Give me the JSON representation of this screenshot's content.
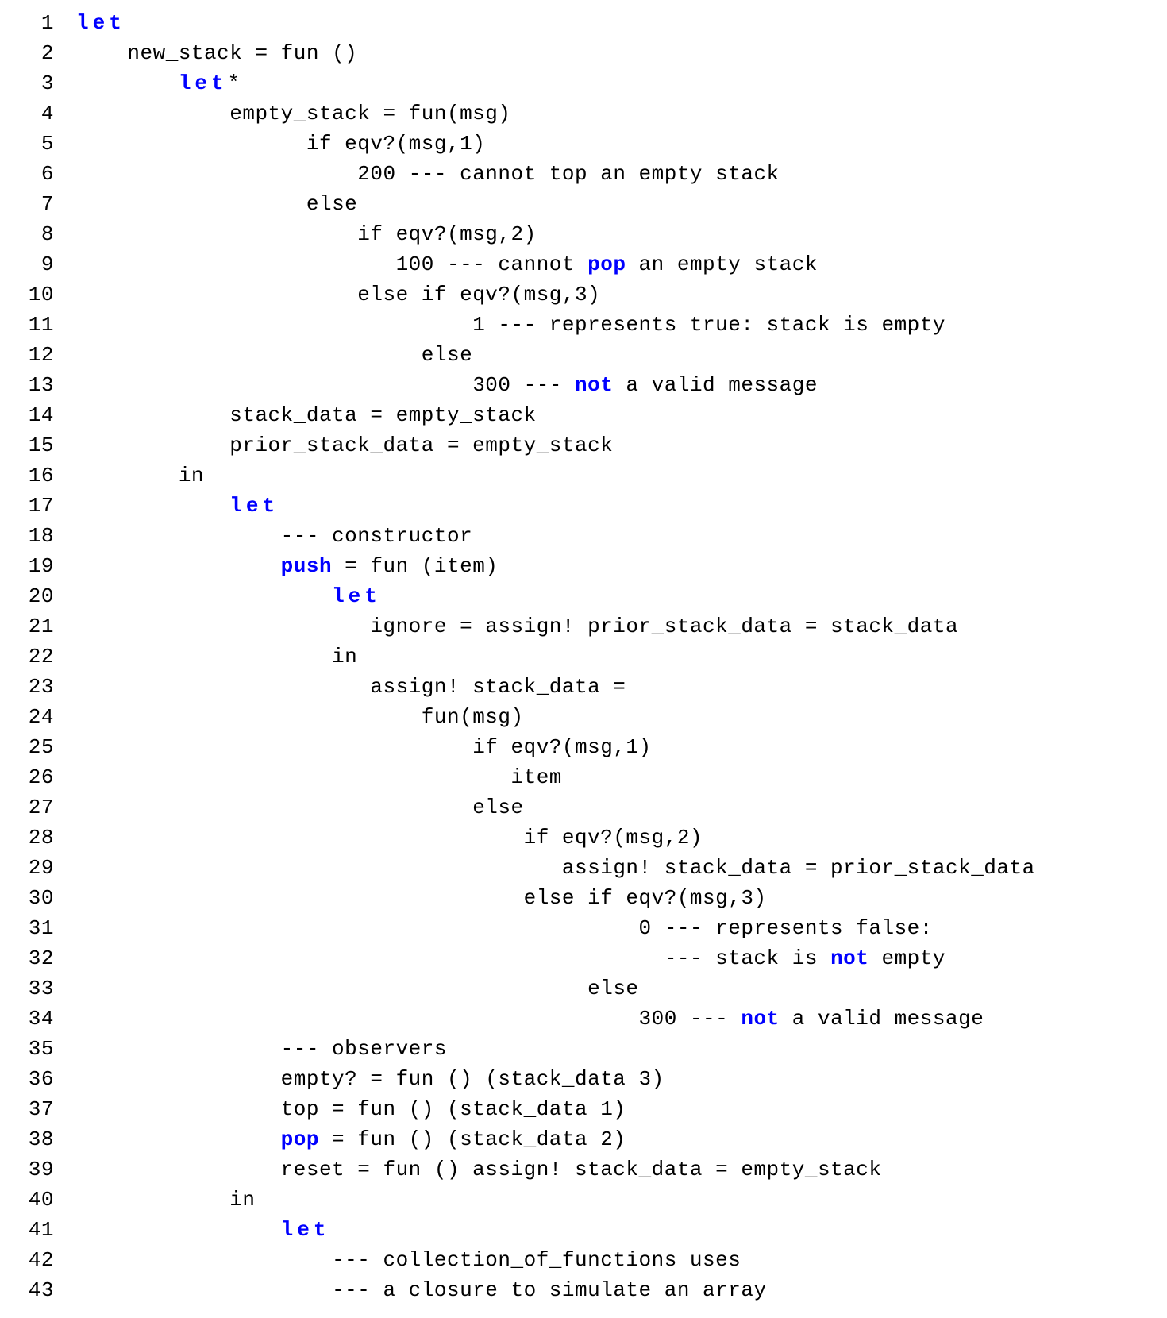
{
  "code": {
    "lines": [
      {
        "n": 1,
        "tokens": [
          {
            "t": "kw",
            "v": "let"
          }
        ]
      },
      {
        "n": 2,
        "indent": 4,
        "tokens": [
          {
            "t": "p",
            "v": "new_stack = fun ()"
          }
        ]
      },
      {
        "n": 3,
        "indent": 8,
        "tokens": [
          {
            "t": "kw",
            "v": "let"
          },
          {
            "t": "p",
            "v": "*"
          }
        ]
      },
      {
        "n": 4,
        "indent": 12,
        "tokens": [
          {
            "t": "p",
            "v": "empty_stack = fun(msg)"
          }
        ]
      },
      {
        "n": 5,
        "indent": 18,
        "tokens": [
          {
            "t": "p",
            "v": "if eqv?(msg,1)"
          }
        ]
      },
      {
        "n": 6,
        "indent": 22,
        "tokens": [
          {
            "t": "p",
            "v": "200 --- cannot top an empty stack"
          }
        ]
      },
      {
        "n": 7,
        "indent": 18,
        "tokens": [
          {
            "t": "p",
            "v": "else"
          }
        ]
      },
      {
        "n": 8,
        "indent": 22,
        "tokens": [
          {
            "t": "p",
            "v": "if eqv?(msg,2)"
          }
        ]
      },
      {
        "n": 9,
        "indent": 25,
        "tokens": [
          {
            "t": "p",
            "v": "100 --- cannot "
          },
          {
            "t": "kw2",
            "v": "pop"
          },
          {
            "t": "p",
            "v": " an empty stack"
          }
        ]
      },
      {
        "n": 10,
        "indent": 22,
        "tokens": [
          {
            "t": "p",
            "v": "else if eqv?(msg,3)"
          }
        ]
      },
      {
        "n": 11,
        "indent": 31,
        "tokens": [
          {
            "t": "p",
            "v": "1 --- represents true: stack is empty"
          }
        ]
      },
      {
        "n": 12,
        "indent": 27,
        "tokens": [
          {
            "t": "p",
            "v": "else"
          }
        ]
      },
      {
        "n": 13,
        "indent": 31,
        "tokens": [
          {
            "t": "p",
            "v": "300 --- "
          },
          {
            "t": "kw2",
            "v": "not"
          },
          {
            "t": "p",
            "v": " a valid message"
          }
        ]
      },
      {
        "n": 14,
        "indent": 12,
        "tokens": [
          {
            "t": "p",
            "v": "stack_data = empty_stack"
          }
        ]
      },
      {
        "n": 15,
        "indent": 12,
        "tokens": [
          {
            "t": "p",
            "v": "prior_stack_data = empty_stack"
          }
        ]
      },
      {
        "n": 16,
        "indent": 8,
        "tokens": [
          {
            "t": "p",
            "v": "in"
          }
        ]
      },
      {
        "n": 17,
        "indent": 12,
        "tokens": [
          {
            "t": "kw",
            "v": "let"
          }
        ]
      },
      {
        "n": 18,
        "indent": 16,
        "tokens": [
          {
            "t": "p",
            "v": "--- constructor"
          }
        ]
      },
      {
        "n": 19,
        "indent": 16,
        "tokens": [
          {
            "t": "kw2",
            "v": "push"
          },
          {
            "t": "p",
            "v": " = fun (item)"
          }
        ]
      },
      {
        "n": 20,
        "indent": 20,
        "tokens": [
          {
            "t": "kw",
            "v": "let"
          }
        ]
      },
      {
        "n": 21,
        "indent": 23,
        "tokens": [
          {
            "t": "p",
            "v": "ignore = assign! prior_stack_data = stack_data"
          }
        ]
      },
      {
        "n": 22,
        "indent": 20,
        "tokens": [
          {
            "t": "p",
            "v": "in"
          }
        ]
      },
      {
        "n": 23,
        "indent": 23,
        "tokens": [
          {
            "t": "p",
            "v": "assign! stack_data ="
          }
        ]
      },
      {
        "n": 24,
        "indent": 27,
        "tokens": [
          {
            "t": "p",
            "v": "fun(msg)"
          }
        ]
      },
      {
        "n": 25,
        "indent": 31,
        "tokens": [
          {
            "t": "p",
            "v": "if eqv?(msg,1)"
          }
        ]
      },
      {
        "n": 26,
        "indent": 34,
        "tokens": [
          {
            "t": "p",
            "v": "item"
          }
        ]
      },
      {
        "n": 27,
        "indent": 31,
        "tokens": [
          {
            "t": "p",
            "v": "else"
          }
        ]
      },
      {
        "n": 28,
        "indent": 35,
        "tokens": [
          {
            "t": "p",
            "v": "if eqv?(msg,2)"
          }
        ]
      },
      {
        "n": 29,
        "indent": 38,
        "tokens": [
          {
            "t": "p",
            "v": "assign! stack_data = prior_stack_data"
          }
        ]
      },
      {
        "n": 30,
        "indent": 35,
        "tokens": [
          {
            "t": "p",
            "v": "else if eqv?(msg,3)"
          }
        ]
      },
      {
        "n": 31,
        "indent": 44,
        "tokens": [
          {
            "t": "p",
            "v": "0 --- represents false:"
          }
        ]
      },
      {
        "n": 32,
        "indent": 46,
        "tokens": [
          {
            "t": "p",
            "v": "--- stack is "
          },
          {
            "t": "kw2",
            "v": "not"
          },
          {
            "t": "p",
            "v": " empty"
          }
        ]
      },
      {
        "n": 33,
        "indent": 40,
        "tokens": [
          {
            "t": "p",
            "v": "else"
          }
        ]
      },
      {
        "n": 34,
        "indent": 44,
        "tokens": [
          {
            "t": "p",
            "v": "300 --- "
          },
          {
            "t": "kw2",
            "v": "not"
          },
          {
            "t": "p",
            "v": " a valid message"
          }
        ]
      },
      {
        "n": 35,
        "indent": 16,
        "tokens": [
          {
            "t": "p",
            "v": "--- observers"
          }
        ]
      },
      {
        "n": 36,
        "indent": 16,
        "tokens": [
          {
            "t": "p",
            "v": "empty? = fun () (stack_data 3)"
          }
        ]
      },
      {
        "n": 37,
        "indent": 16,
        "tokens": [
          {
            "t": "p",
            "v": "top = fun () (stack_data 1)"
          }
        ]
      },
      {
        "n": 38,
        "indent": 16,
        "tokens": [
          {
            "t": "kw2",
            "v": "pop"
          },
          {
            "t": "p",
            "v": " = fun () (stack_data 2)"
          }
        ]
      },
      {
        "n": 39,
        "indent": 16,
        "tokens": [
          {
            "t": "p",
            "v": "reset = fun () assign! stack_data = empty_stack"
          }
        ]
      },
      {
        "n": 40,
        "indent": 12,
        "tokens": [
          {
            "t": "p",
            "v": "in"
          }
        ]
      },
      {
        "n": 41,
        "indent": 16,
        "tokens": [
          {
            "t": "kw",
            "v": "let"
          }
        ]
      },
      {
        "n": 42,
        "indent": 20,
        "tokens": [
          {
            "t": "p",
            "v": "--- collection_of_functions uses"
          }
        ]
      },
      {
        "n": 43,
        "indent": 20,
        "tokens": [
          {
            "t": "p",
            "v": "--- a closure to simulate an array"
          }
        ]
      }
    ]
  }
}
